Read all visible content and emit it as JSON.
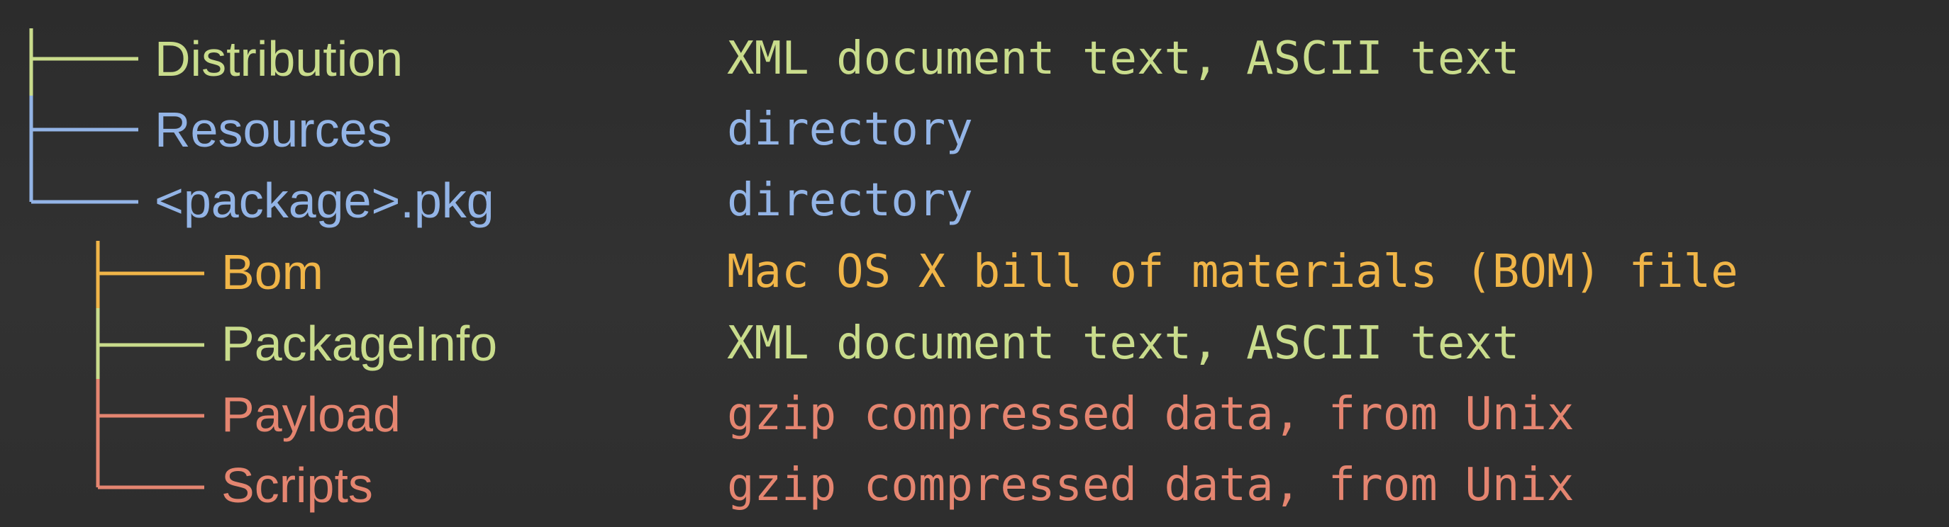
{
  "colors": {
    "background": "#2f2f2f",
    "green": "#c9dc8c",
    "blue": "#93b4e6",
    "orange": "#f0b548",
    "red": "#e48570"
  },
  "tree": [
    {
      "name": "Distribution",
      "description": "XML document text, ASCII text",
      "color": "#c9dc8c"
    },
    {
      "name": "Resources",
      "description": "directory",
      "color": "#93b4e6"
    },
    {
      "name": "<package>.pkg",
      "description": "directory",
      "color": "#93b4e6"
    },
    {
      "name": "Bom",
      "description": "Mac OS X bill of materials (BOM) file",
      "color": "#f0b548"
    },
    {
      "name": "PackageInfo",
      "description": "XML document text, ASCII text",
      "color": "#c9dc8c"
    },
    {
      "name": "Payload",
      "description": "gzip compressed data, from Unix",
      "color": "#e48570"
    },
    {
      "name": "Scripts",
      "description": "gzip compressed data, from Unix",
      "color": "#e48570"
    }
  ]
}
